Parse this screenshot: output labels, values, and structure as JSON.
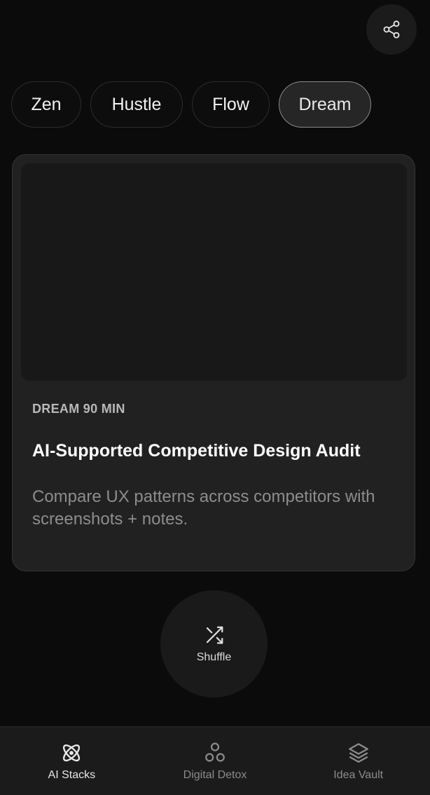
{
  "header": {
    "share_icon": "share-icon"
  },
  "modes": [
    {
      "label": "Zen",
      "active": false
    },
    {
      "label": "Hustle",
      "active": false
    },
    {
      "label": "Flow",
      "active": false
    },
    {
      "label": "Dream",
      "active": true
    }
  ],
  "card": {
    "meta": "DREAM 90 MIN",
    "title": "AI-Supported Competitive Design Audit",
    "description": "Compare UX patterns across competitors with screenshots + notes."
  },
  "shuffle": {
    "label": "Shuffle",
    "icon": "shuffle-icon"
  },
  "tabs": [
    {
      "label": "AI Stacks",
      "icon": "atom-icon",
      "active": true
    },
    {
      "label": "Digital Detox",
      "icon": "circles-icon",
      "active": false
    },
    {
      "label": "Idea Vault",
      "icon": "layers-icon",
      "active": false
    }
  ],
  "colors": {
    "background": "#0b0b0b",
    "card": "#212121",
    "active_pill_border": "#8a8a8a"
  }
}
